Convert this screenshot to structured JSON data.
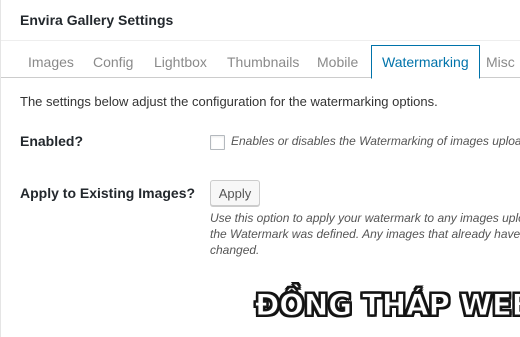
{
  "header": {
    "title": "Envira Gallery Settings"
  },
  "tabs": [
    {
      "label": "Images"
    },
    {
      "label": "Config"
    },
    {
      "label": "Lightbox"
    },
    {
      "label": "Thumbnails"
    },
    {
      "label": "Mobile"
    },
    {
      "label": "Watermarking",
      "active": true
    },
    {
      "label": "Misc"
    }
  ],
  "intro": "The settings below adjust the configuration for the watermarking options.",
  "enabled": {
    "label": "Enabled?",
    "checked": false,
    "description": "Enables or disables the Watermarking of images uploaded"
  },
  "apply_existing": {
    "label": "Apply to Existing Images?",
    "button_label": "Apply",
    "description_lines": [
      "Use this option to apply your watermark to any images uploa",
      "the Watermark was defined. Any images that already have a w",
      "changed."
    ]
  },
  "overlay_watermark": "ĐỒNG THÁP WEB",
  "colors": {
    "accent": "#0073aa",
    "tab_inactive": "#8a8a8a"
  }
}
